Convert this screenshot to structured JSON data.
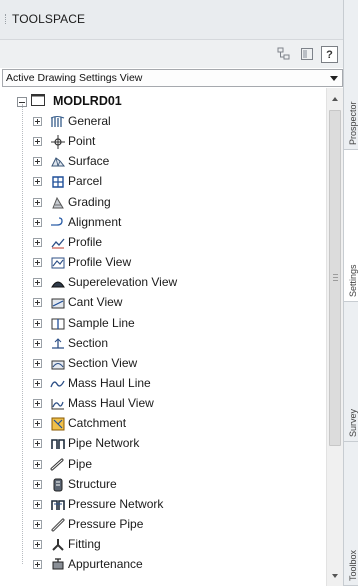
{
  "panel": {
    "title": "TOOLSPACE"
  },
  "toolbar": {
    "help_label": "?"
  },
  "view_selector": {
    "value": "Active Drawing Settings View"
  },
  "tree": {
    "root_label": "MODLRD01",
    "items": [
      {
        "label": "General",
        "icon": "general-icon"
      },
      {
        "label": "Point",
        "icon": "point-icon"
      },
      {
        "label": "Surface",
        "icon": "surface-icon"
      },
      {
        "label": "Parcel",
        "icon": "parcel-icon"
      },
      {
        "label": "Grading",
        "icon": "grading-icon"
      },
      {
        "label": "Alignment",
        "icon": "alignment-icon"
      },
      {
        "label": "Profile",
        "icon": "profile-icon"
      },
      {
        "label": "Profile View",
        "icon": "profile-view-icon"
      },
      {
        "label": "Superelevation View",
        "icon": "superelevation-view-icon"
      },
      {
        "label": "Cant View",
        "icon": "cant-view-icon"
      },
      {
        "label": "Sample Line",
        "icon": "sample-line-icon"
      },
      {
        "label": "Section",
        "icon": "section-icon"
      },
      {
        "label": "Section View",
        "icon": "section-view-icon"
      },
      {
        "label": "Mass Haul Line",
        "icon": "mass-haul-line-icon"
      },
      {
        "label": "Mass Haul View",
        "icon": "mass-haul-view-icon"
      },
      {
        "label": "Catchment",
        "icon": "catchment-icon"
      },
      {
        "label": "Pipe Network",
        "icon": "pipe-network-icon"
      },
      {
        "label": "Pipe",
        "icon": "pipe-icon"
      },
      {
        "label": "Structure",
        "icon": "structure-icon"
      },
      {
        "label": "Pressure Network",
        "icon": "pressure-network-icon"
      },
      {
        "label": "Pressure Pipe",
        "icon": "pressure-pipe-icon"
      },
      {
        "label": "Fitting",
        "icon": "fitting-icon"
      },
      {
        "label": "Appurtenance",
        "icon": "appurtenance-icon"
      }
    ]
  },
  "side_tabs": [
    {
      "label": "Prospector"
    },
    {
      "label": "Settings"
    },
    {
      "label": "Survey"
    },
    {
      "label": "Toolbox"
    }
  ]
}
